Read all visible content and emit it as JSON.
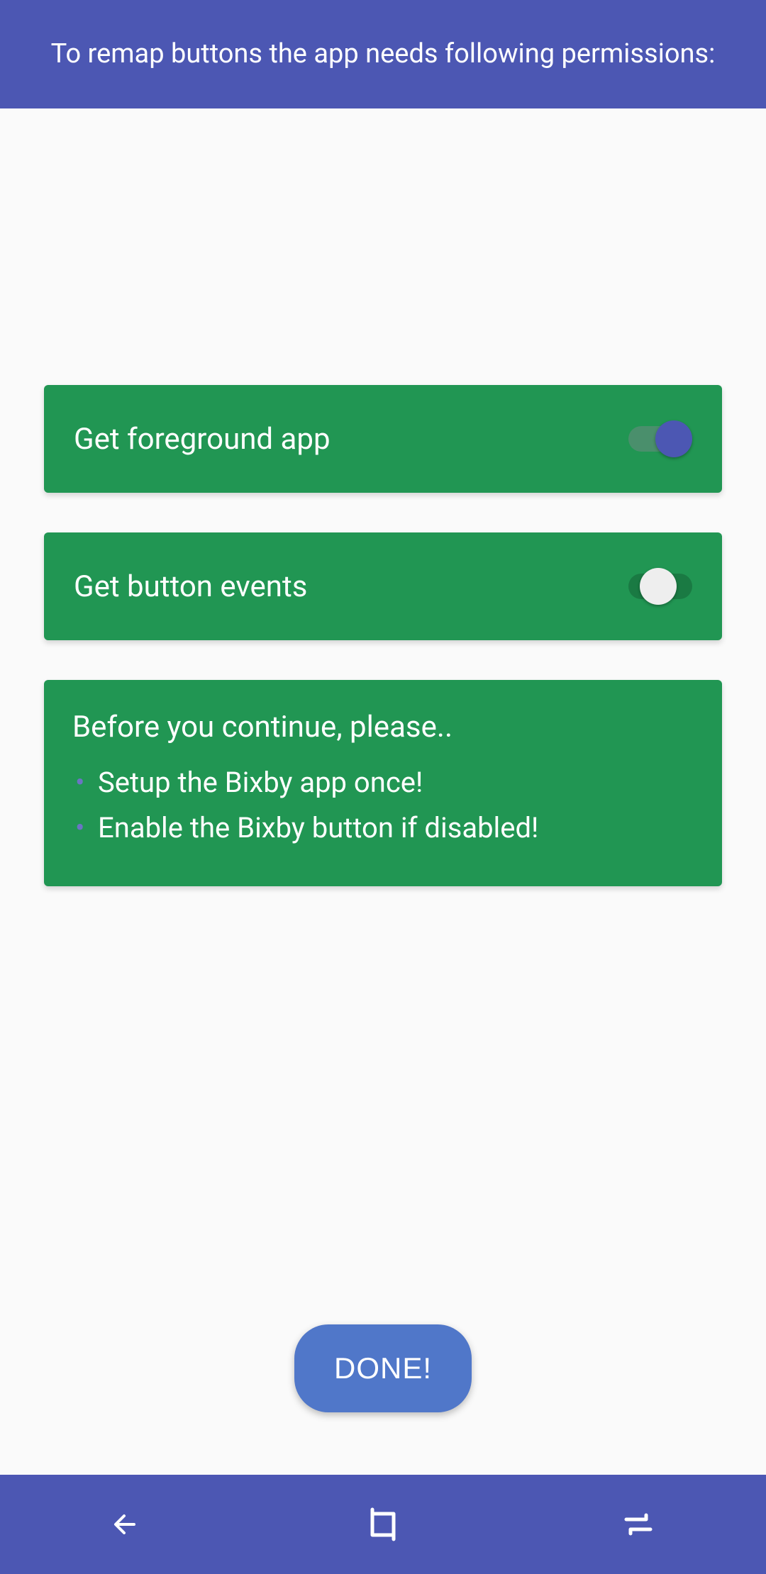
{
  "header": {
    "title": "To remap buttons the app needs following permissions:"
  },
  "permissions": [
    {
      "label": "Get foreground app",
      "switchVariant": "blue"
    },
    {
      "label": "Get button events",
      "switchVariant": "white"
    }
  ],
  "info": {
    "title": "Before you continue, please..",
    "items": [
      "Setup the Bixby app once!",
      "Enable the Bixby button if disabled!"
    ]
  },
  "buttons": {
    "done": "DONE!"
  }
}
